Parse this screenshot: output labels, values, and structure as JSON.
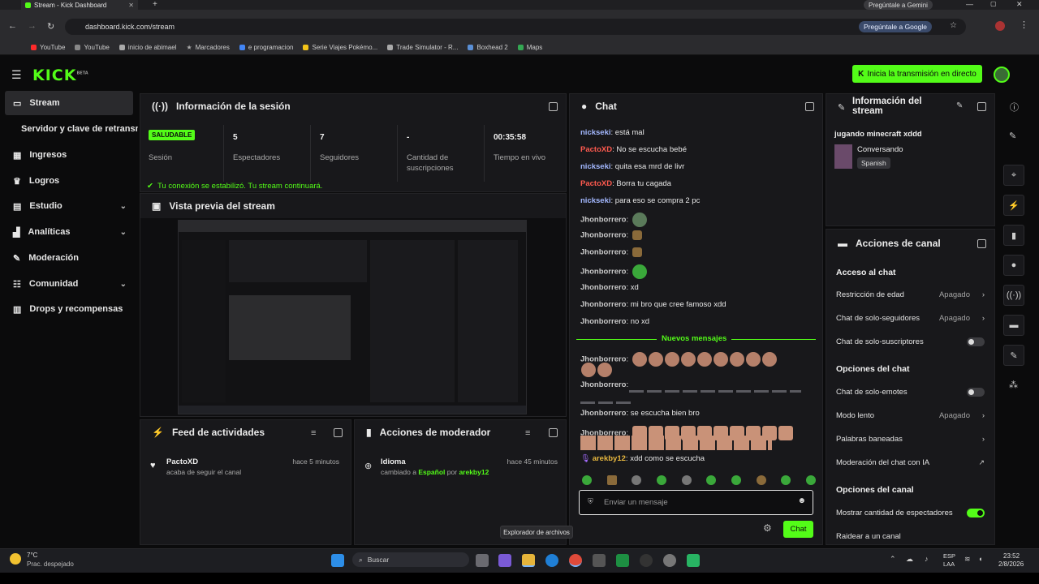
{
  "browser": {
    "tab_title": "Stream - Kick Dashboard",
    "url": "dashboard.kick.com/stream",
    "gemini_label": "Pregúntale a Gemini",
    "google_label": "Pregúntale a Google",
    "bookmarks": [
      "YouTube",
      "YouTube",
      "inicio de abimael",
      "Marcadores",
      "e programacion",
      "Serie Viajes Pokémo...",
      "Trade Simulator - R...",
      "Boxhead 2",
      "Maps"
    ]
  },
  "app": {
    "logo": "KICK",
    "logo_beta": "BETA",
    "go_live": "Inicia la transmisión en directo"
  },
  "sidebar": {
    "items": [
      {
        "label": "Stream",
        "icon": "video-icon"
      },
      {
        "label": "Servidor y clave de retransmisión"
      },
      {
        "label": "Ingresos",
        "icon": "dollar-icon"
      },
      {
        "label": "Logros",
        "icon": "trophy-icon"
      },
      {
        "label": "Estudio",
        "icon": "studio-icon"
      },
      {
        "label": "Analíticas",
        "icon": "chart-icon"
      },
      {
        "label": "Moderación",
        "icon": "wrench-icon"
      },
      {
        "label": "Comunidad",
        "icon": "community-icon"
      },
      {
        "label": "Drops y recompensas",
        "icon": "drops-icon"
      }
    ]
  },
  "session": {
    "title": "Información de la sesión",
    "badge": "SALUDABLE",
    "stats": [
      {
        "value": "",
        "label": "Sesión"
      },
      {
        "value": "5",
        "label": "Espectadores"
      },
      {
        "value": "7",
        "label": "Seguidores"
      },
      {
        "value": "-",
        "label": "Cantidad de suscripciones"
      },
      {
        "value": "00:35:58",
        "label": "Tiempo en vivo"
      }
    ],
    "notice": "Tu conexión se estabilizó. Tu stream continuará."
  },
  "preview": {
    "title": "Vista previa del stream"
  },
  "activity": {
    "title": "Feed de actividades",
    "user": "PactoXD",
    "time": "hace 5 minutos",
    "action": "acaba de seguir el canal"
  },
  "modactions": {
    "title": "Acciones de moderador",
    "item_title": "Idioma",
    "time": "hace 45 minutos",
    "desc_prefix": "cambiado a",
    "desc_lang": "Español",
    "desc_mid": "por",
    "desc_user": "arekby12"
  },
  "chat": {
    "title": "Chat",
    "messages": [
      {
        "user": "nickseki",
        "text": "está mal",
        "color": "blue"
      },
      {
        "user": "PactoXD",
        "text": "No se escucha bebé",
        "color": "red"
      },
      {
        "user": "nickseki",
        "text": "quita esa mrd de livr",
        "color": "blue"
      },
      {
        "user": "PactoXD",
        "text": "Borra tu cagada",
        "color": "red"
      },
      {
        "user": "nickseki",
        "text": "para eso se compra 2 pc",
        "color": "blue"
      },
      {
        "user": "Jhonborrero",
        "text": "",
        "color": "gray"
      },
      {
        "user": "Jhonborrero",
        "text": "",
        "color": "gray"
      },
      {
        "user": "Jhonborrero",
        "text": "",
        "color": "gray"
      },
      {
        "user": "Jhonborrero",
        "text": "",
        "color": "gray"
      },
      {
        "user": "Jhonborrero",
        "text": "xd",
        "color": "gray"
      },
      {
        "user": "Jhonborrero",
        "text": "mi bro que cree famoso xdd",
        "color": "gray"
      },
      {
        "user": "Jhonborrero",
        "text": "no xd",
        "color": "gray"
      }
    ],
    "new_messages": "Nuevos mensajes",
    "after": [
      {
        "user": "Jhonborrero",
        "text": ""
      },
      {
        "user": "Jhonborrero",
        "text": ""
      },
      {
        "user": "Jhonborrero",
        "text": "se escucha bien bro"
      },
      {
        "user": "Jhonborrero",
        "text": ""
      },
      {
        "user": "arekby12",
        "text": "xdd como se escucha"
      }
    ],
    "placeholder": "Enviar un mensaje",
    "send": "Chat"
  },
  "streaminfo": {
    "title": "Información del stream",
    "stream_title": "jugando minecraft xddd",
    "category": "Conversando",
    "language": "Spanish"
  },
  "channel": {
    "title": "Acciones de canal",
    "chat_access": "Acceso al chat",
    "age": {
      "label": "Restricción de edad",
      "value": "Apagado"
    },
    "followers": {
      "label": "Chat de solo-seguidores",
      "value": "Apagado"
    },
    "subs": {
      "label": "Chat de solo-suscriptores"
    },
    "chat_options": "Opciones del chat",
    "emotes": {
      "label": "Chat de solo-emotes"
    },
    "slow": {
      "label": "Modo lento",
      "value": "Apagado"
    },
    "banned": {
      "label": "Palabras baneadas"
    },
    "ai": {
      "label": "Moderación del chat con IA"
    },
    "channel_options": "Opciones del canal",
    "viewers": {
      "label": "Mostrar cantidad de espectadores"
    },
    "raid": {
      "label": "Raidear a un canal"
    }
  },
  "taskbar": {
    "weather_temp": "7°C",
    "weather_desc": "Prac. despejado",
    "search": "Buscar",
    "tooltip": "Explorador de archivos",
    "lang1": "ESP",
    "lang2": "LAA",
    "time": "23:52",
    "date": "2/8/2026"
  }
}
